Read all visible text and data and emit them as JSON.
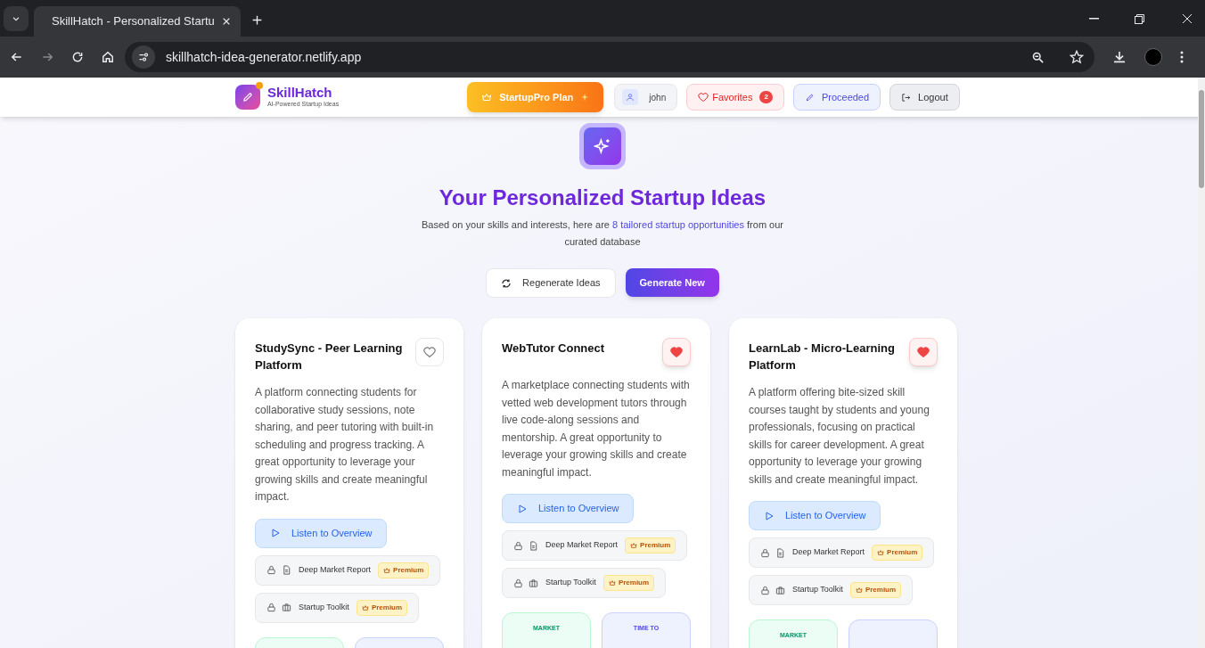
{
  "browser": {
    "tab_title": "SkillHatch - Personalized Startu",
    "url": "skillhatch-idea-generator.netlify.app"
  },
  "header": {
    "brand": "SkillHatch",
    "tagline": "AI-Powered Startup Ideas",
    "plan": "StartupPro Plan",
    "user": "john",
    "favorites": {
      "label": "Favorites",
      "count": "2"
    },
    "proceeded": "Proceeded",
    "logout": "Logout"
  },
  "hero": {
    "title": "Your Personalized Startup Ideas",
    "subtitle": "Based on your skills and interests, here are **8 tailored startup opportunities** from our curated database",
    "buttons": [
      {
        "label": "Regenerate Ideas",
        "kind": "secondary"
      },
      {
        "label": "Generate New",
        "kind": "primary"
      }
    ]
  },
  "cards": [
    {
      "title": "StudySync - Peer Learning Platform",
      "favorite": false,
      "description": "A platform connecting students for collaborative study sessions, note sharing, and peer tutoring with built-in scheduling and progress tracking. A great opportunity to leverage your growing skills and create meaningful impact.",
      "listen": "Listen to Overview",
      "locked": [
        {
          "label": "Deep Market Report",
          "kind": "report",
          "badge": "Premium"
        },
        {
          "label": "Startup Toolkit",
          "kind": "toolkit",
          "badge": "Premium"
        }
      ],
      "stats": [
        {
          "kind": "market"
        },
        {
          "kind": "time"
        }
      ]
    },
    {
      "title": "WebTutor Connect",
      "favorite": true,
      "description": "A marketplace connecting students with vetted web development tutors through live code-along sessions and mentorship. A great opportunity to leverage your growing skills and create meaningful impact.",
      "listen": "Listen to Overview",
      "locked": [
        {
          "label": "Deep Market Report",
          "kind": "report",
          "badge": "Premium"
        },
        {
          "label": "Startup Toolkit",
          "kind": "toolkit",
          "badge": "Premium"
        }
      ],
      "stats": [
        {
          "kind": "market",
          "label": "MARKET"
        },
        {
          "kind": "time",
          "label": "TIME TO"
        }
      ]
    },
    {
      "title": "LearnLab - Micro-Learning Platform",
      "favorite": true,
      "description": "A platform offering bite-sized skill courses taught by students and young professionals, focusing on practical skills for career development. A great opportunity to leverage your growing skills and create meaningful impact.",
      "listen": "Listen to Overview",
      "locked": [
        {
          "label": "Deep Market Report",
          "kind": "report",
          "badge": "Premium"
        },
        {
          "label": "Startup Toolkit",
          "kind": "toolkit",
          "badge": "Premium"
        }
      ],
      "stats": [
        {
          "kind": "market",
          "label": "MARKET"
        },
        {
          "kind": "time"
        }
      ]
    }
  ]
}
